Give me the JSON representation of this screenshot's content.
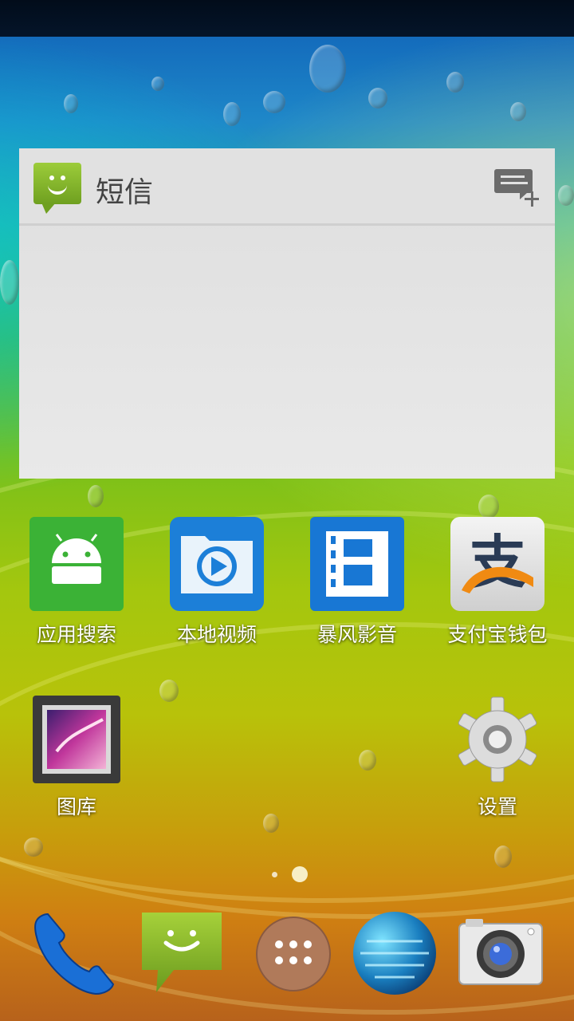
{
  "widget": {
    "title": "短信",
    "app_icon": "messaging-icon",
    "compose_icon": "new-message-icon"
  },
  "apps": [
    {
      "label": "应用搜索",
      "icon": "android-search-icon"
    },
    {
      "label": "本地视频",
      "icon": "local-video-icon"
    },
    {
      "label": "暴风影音",
      "icon": "baofeng-player-icon"
    },
    {
      "label": "支付宝钱包",
      "icon": "alipay-icon"
    },
    {
      "label": "图库",
      "icon": "gallery-icon"
    },
    {
      "label": "设置",
      "icon": "settings-gear-icon"
    }
  ],
  "page_indicator": {
    "pages": 2,
    "current": 2
  },
  "dock": [
    {
      "icon": "phone-icon"
    },
    {
      "icon": "messaging-icon"
    },
    {
      "icon": "app-drawer-icon"
    },
    {
      "icon": "browser-globe-icon"
    },
    {
      "icon": "camera-icon"
    }
  ],
  "colors": {
    "android_green": "#3bb236",
    "video_blue": "#1c7fd8",
    "alipay_orange": "#f08a12"
  }
}
